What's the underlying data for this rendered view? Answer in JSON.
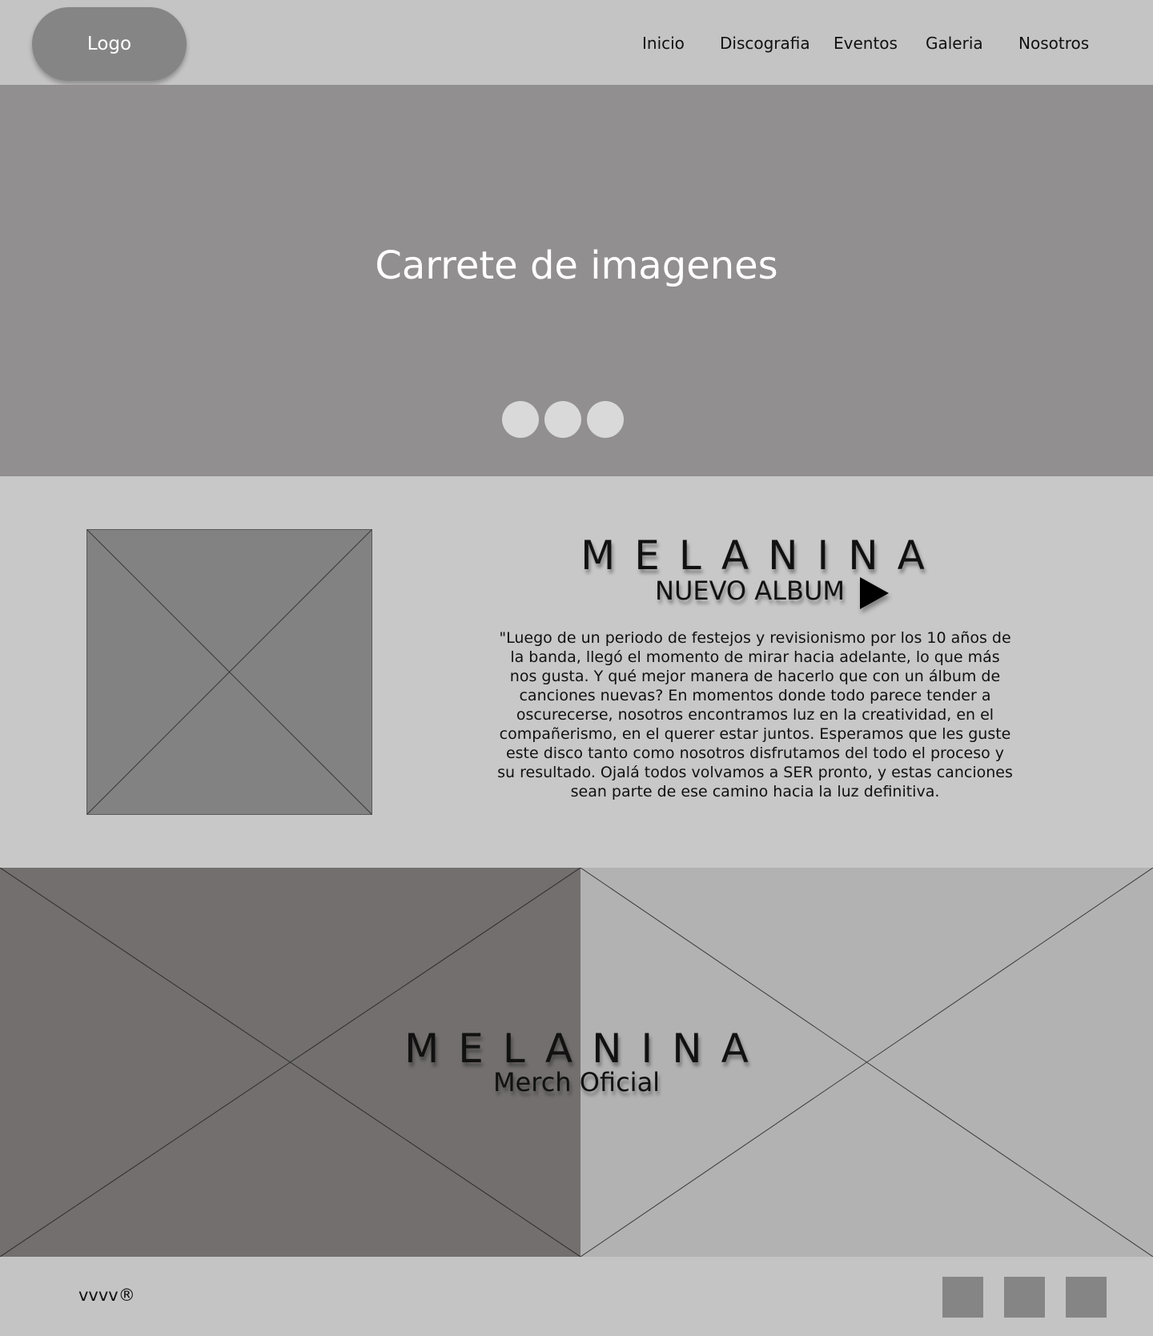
{
  "header": {
    "logo_label": "Logo",
    "nav": [
      "Inicio",
      "Discografia",
      "Eventos",
      "Galeria",
      "Nosotros"
    ]
  },
  "hero": {
    "title": "Carrete de imagenes",
    "dot_count": 3
  },
  "album": {
    "band_name": "MELANINA",
    "subtitle": "NUEVO ALBUM",
    "description": "\"Luego de un periodo de festejos y revisionismo por los 10 años de la banda, llegó el momento de mirar hacia adelante, lo que más nos gusta. Y qué mejor manera de hacerlo que con un álbum de canciones nuevas? En momentos donde todo parece tender a oscurecerse, nosotros encontramos luz en la creatividad, en el compañerismo, en el querer estar juntos. Esperamos que les guste este disco tanto como nosotros disfrutamos del todo el proceso y su resultado. Ojalá todos volvamos a SER pronto, y estas canciones sean parte de ese camino hacia la luz definitiva."
  },
  "merch": {
    "band_name": "MELANINA",
    "subtitle": "Merch Oficial"
  },
  "footer": {
    "copyright": "vvvv®",
    "social_icons": [
      "social-icon-1",
      "social-icon-2",
      "social-icon-3"
    ]
  },
  "colors": {
    "page_bg": "#c4c4c4",
    "hero_bg": "#918f90",
    "album_bg": "#c8c8c8",
    "placeholder": "#828282",
    "merch_left": "#726f6e",
    "merch_right": "#b3b2b3",
    "dot": "#d9d9d9"
  }
}
